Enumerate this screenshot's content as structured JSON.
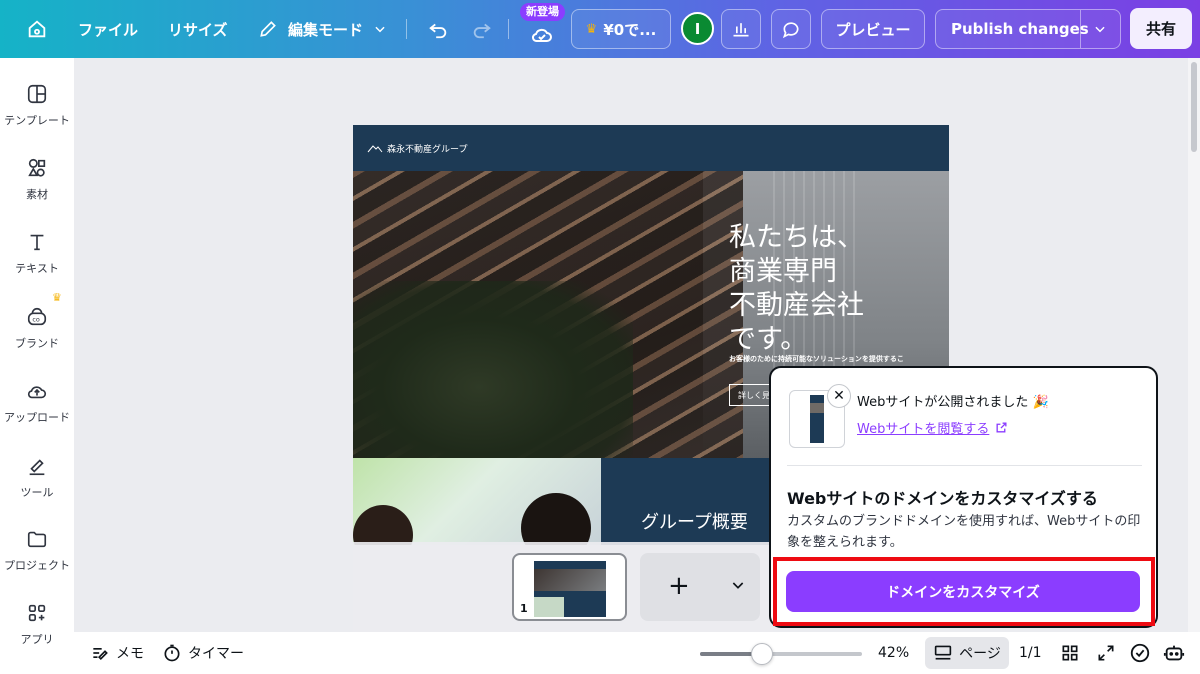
{
  "topbar": {
    "file_label": "ファイル",
    "resize_label": "リサイズ",
    "edit_mode_label": "編集モード",
    "new_badge": "新登場",
    "pro_label": "¥0で...",
    "avatar_initial": "I",
    "preview_label": "プレビュー",
    "publish_label": "Publish changes",
    "share_label": "共有"
  },
  "sidebar": {
    "items": [
      {
        "label": "テンプレート",
        "icon": "template-icon"
      },
      {
        "label": "素材",
        "icon": "elements-icon"
      },
      {
        "label": "テキスト",
        "icon": "text-icon"
      },
      {
        "label": "ブランド",
        "icon": "brand-icon"
      },
      {
        "label": "アップロード",
        "icon": "upload-icon"
      },
      {
        "label": "ツール",
        "icon": "tools-icon"
      },
      {
        "label": "プロジェクト",
        "icon": "folder-icon"
      },
      {
        "label": "アプリ",
        "icon": "apps-icon"
      }
    ]
  },
  "canvas": {
    "site_logo": "森永不動産グループ",
    "hero_title_lines": [
      "私たちは、",
      "商業専門",
      "不動産会社",
      "です。"
    ],
    "hero_sub": "お客様のために持続可能なソリューションを提供するこ",
    "hero_more": "詳しく見",
    "section_title": "グループ概要"
  },
  "pages": {
    "current_number": "1"
  },
  "popup": {
    "published_text": "Webサイトが公開されました 🎉",
    "view_link": "Webサイトを閲覧する",
    "title": "Webサイトのドメインをカスタマイズする",
    "description": "カスタムのブランドドメインを使用すれば、Webサイトの印象を整えられます。",
    "cta_label": "ドメインをカスタマイズ"
  },
  "bottombar": {
    "notes_label": "メモ",
    "timer_label": "タイマー",
    "zoom_percent": "42%",
    "zoom_value": 42,
    "page_label": "ページ",
    "page_count": "1/1"
  },
  "colors": {
    "accent": "#8b3dff",
    "highlight_border": "#ee0b12",
    "site_navy": "#1d3a55"
  }
}
